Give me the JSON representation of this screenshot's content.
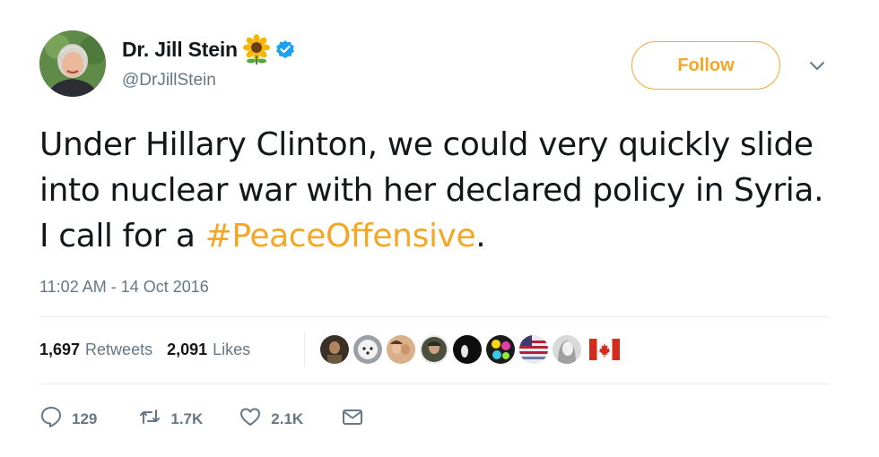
{
  "author": {
    "display_name": "Dr. Jill Stein",
    "handle": "@DrJillStein",
    "emoji": "sunflower-icon",
    "verified": true
  },
  "follow_button": {
    "label": "Follow"
  },
  "tweet": {
    "text_before": "Under Hillary Clinton, we could very quickly slide into nuclear war with her declared policy in Syria. I call for a ",
    "hashtag": "#PeaceOffensive",
    "text_after": ".",
    "timestamp": "11:02 AM - 14 Oct 2016"
  },
  "stats": {
    "retweets_count": "1,697",
    "retweets_label": "Retweets",
    "likes_count": "2,091",
    "likes_label": "Likes"
  },
  "likers": [
    {
      "name": "liker-avatar-1",
      "color": "#3a3028"
    },
    {
      "name": "liker-avatar-2",
      "color": "#c8c8c8"
    },
    {
      "name": "liker-avatar-3",
      "color": "#c9956c"
    },
    {
      "name": "liker-avatar-4",
      "color": "#4b4f3e"
    },
    {
      "name": "liker-avatar-5",
      "color": "#111111"
    },
    {
      "name": "liker-avatar-6",
      "color": "#2a2a2a"
    },
    {
      "name": "liker-avatar-7",
      "color": "#6b7ca8"
    },
    {
      "name": "liker-avatar-8",
      "color": "#d9d9d9"
    },
    {
      "name": "canada-flag-icon",
      "color": "#d52b1e"
    }
  ],
  "actions": {
    "reply_count": "129",
    "retweet_count": "1.7K",
    "like_count": "2.1K"
  },
  "colors": {
    "accent": "#f5a623",
    "text": "#14171a",
    "muted": "#657786",
    "verified": "#1da1f2",
    "divider": "#e6ecf0"
  }
}
